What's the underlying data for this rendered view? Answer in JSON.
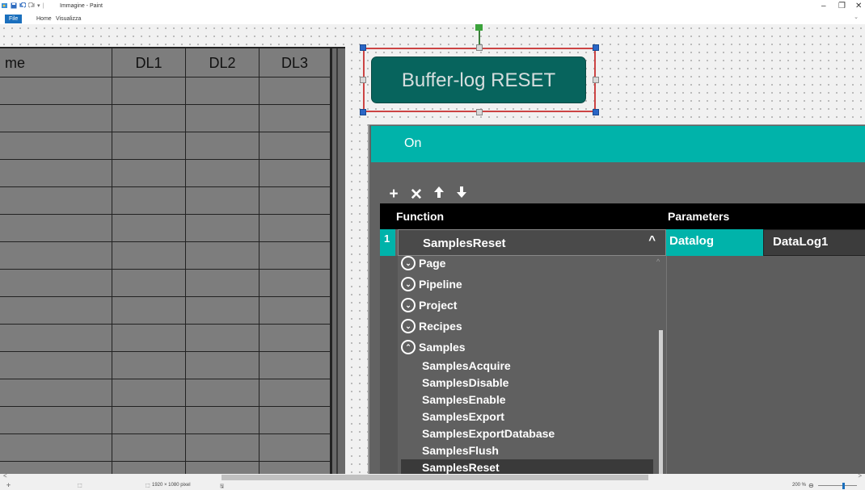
{
  "window": {
    "title": "Immagine - Paint",
    "controls": {
      "minimize": "–",
      "maximize": "❐",
      "close": "✕"
    }
  },
  "ribbon": {
    "tabs": [
      "File",
      "Home",
      "Visualizza"
    ],
    "collapse": "⌄"
  },
  "table": {
    "headers": [
      "me",
      "DL1",
      "DL2",
      "DL3"
    ],
    "row_count": 15
  },
  "canvas_button": {
    "label": "Buffer-log RESET",
    "color": "#07645d"
  },
  "dialog": {
    "title": "On",
    "accent": "#00b3aa",
    "toolbar": {
      "add": "+",
      "remove": "✕",
      "up": "🡅",
      "down": "🡇"
    },
    "columns": {
      "function": "Function",
      "parameters": "Parameters"
    },
    "row": {
      "index": "1",
      "function": "SamplesReset",
      "chevron": "^",
      "param_name": "Datalog",
      "param_value": "DataLog1"
    },
    "dropdown": {
      "groups": [
        {
          "label": "Page",
          "expanded": false
        },
        {
          "label": "Pipeline",
          "expanded": false
        },
        {
          "label": "Project",
          "expanded": false
        },
        {
          "label": "Recipes",
          "expanded": false
        },
        {
          "label": "Samples",
          "expanded": true
        }
      ],
      "items": [
        "SamplesAcquire",
        "SamplesDisable",
        "SamplesEnable",
        "SamplesExport",
        "SamplesExportDatabase",
        "SamplesFlush",
        "SamplesReset"
      ],
      "selected": "SamplesReset",
      "group_icon_collapsed": "⌄",
      "group_icon_expanded": "⌃"
    }
  },
  "statusbar": {
    "image_size": "1920 × 1080 pixel",
    "zoom": "200 %",
    "zoom_out": "⊖"
  }
}
